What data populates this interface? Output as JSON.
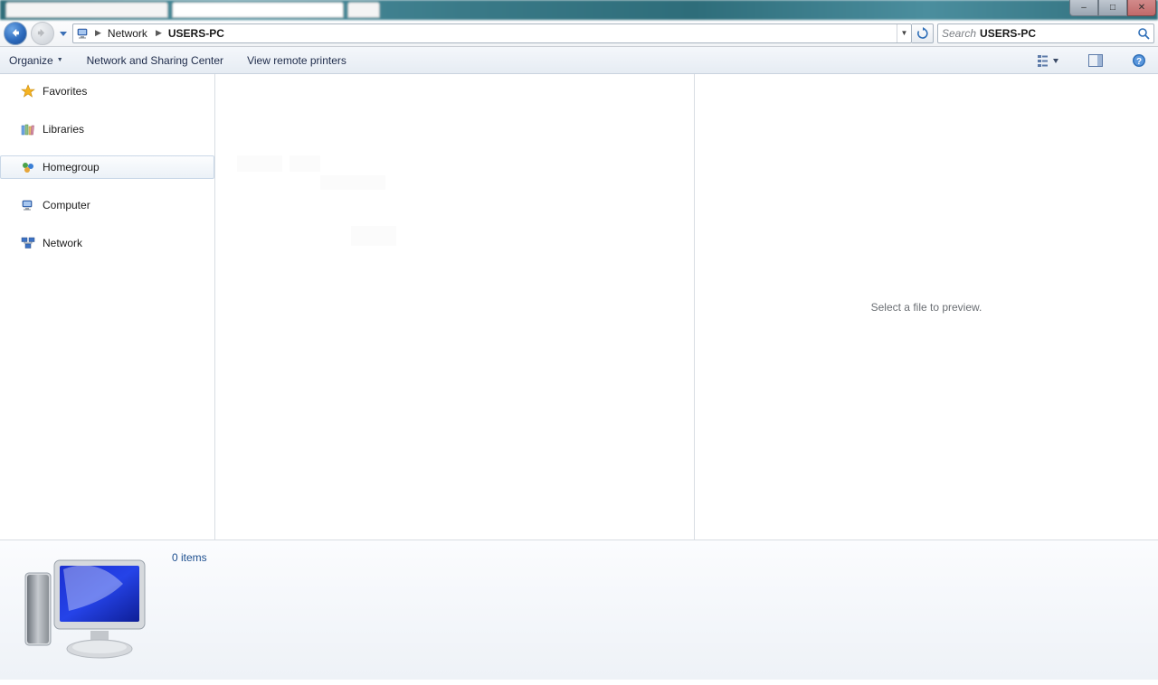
{
  "window_controls": {
    "min": "–",
    "max": "□",
    "close": "✕"
  },
  "breadcrumb": {
    "root_icon": "computer-icon",
    "segments": [
      {
        "label": "Network",
        "bold": false
      },
      {
        "label": "USERS-PC",
        "bold": true
      }
    ]
  },
  "search": {
    "placeholder": "Search",
    "query": "USERS-PC"
  },
  "commands": {
    "organize": "Organize",
    "network_center": "Network and Sharing Center",
    "remote_printers": "View remote printers"
  },
  "sidebar": {
    "items": [
      {
        "id": "favorites",
        "label": "Favorites",
        "icon": "star-icon",
        "selected": false
      },
      {
        "id": "libraries",
        "label": "Libraries",
        "icon": "libraries-icon",
        "selected": false
      },
      {
        "id": "homegroup",
        "label": "Homegroup",
        "icon": "homegroup-icon",
        "selected": true
      },
      {
        "id": "computer",
        "label": "Computer",
        "icon": "computer-icon",
        "selected": false
      },
      {
        "id": "network",
        "label": "Network",
        "icon": "network-icon",
        "selected": false
      }
    ]
  },
  "preview": {
    "empty_text": "Select a file to preview."
  },
  "details": {
    "item_count_text": "0 items"
  }
}
